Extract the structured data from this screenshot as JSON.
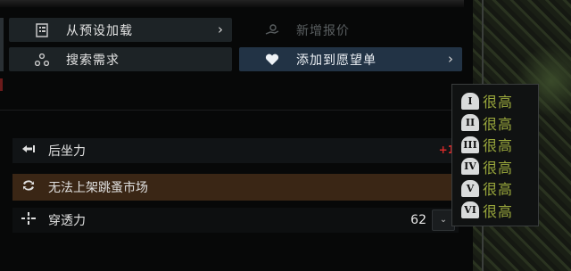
{
  "menu": {
    "preset": {
      "icon": "preset-list-icon",
      "label": "从预设加载"
    },
    "quote": {
      "icon": "hand-coin-icon",
      "label": "新增报价"
    },
    "search": {
      "icon": "nodes-icon",
      "label": "搜索需求"
    },
    "wishlist": {
      "icon": "heart-icon",
      "label": "添加到愿望单"
    }
  },
  "stats": {
    "recoil": {
      "icon": "recoil-arrow-icon",
      "label": "后坐力",
      "value": "+1"
    },
    "market": {
      "icon": "no-trade-icon",
      "label": "无法上架跳蚤市场"
    },
    "penetration": {
      "icon": "burst-icon",
      "label": "穿透力",
      "value": "62",
      "dropdown_icon": "chevron-down-icon"
    }
  },
  "tooltip": {
    "rows": [
      {
        "tier": "I",
        "value": "很高"
      },
      {
        "tier": "II",
        "value": "很高"
      },
      {
        "tier": "III",
        "value": "很高"
      },
      {
        "tier": "IV",
        "value": "很高"
      },
      {
        "tier": "V",
        "value": "很高"
      },
      {
        "tier": "VI",
        "value": "很高"
      }
    ]
  },
  "colors": {
    "accent_blue": "#223345",
    "market_brown": "#3a2615",
    "recoil_red": "#d72a2a",
    "tooltip_green": "#9aa83c"
  }
}
